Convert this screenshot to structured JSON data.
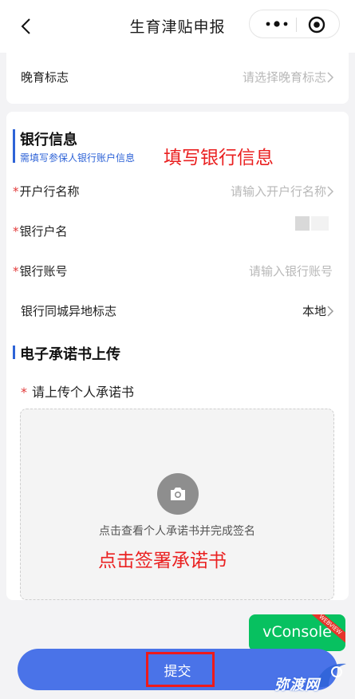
{
  "nav": {
    "title": "生育津贴申报",
    "back_icon": "chevron-left-icon",
    "more_icon": "more-dots-icon",
    "close_icon": "target-close-icon"
  },
  "late_birth": {
    "label": "晚育标志",
    "placeholder": "请选择晚育标志"
  },
  "bank": {
    "title": "银行信息",
    "subtitle": "需填写参保人银行账户信息",
    "annotation": "填写银行信息",
    "fields": [
      {
        "required": "*",
        "label": "开户行名称",
        "placeholder": "请输入开户行名称"
      },
      {
        "required": "*",
        "label": "银行户名",
        "value": ""
      },
      {
        "required": "*",
        "label": "银行账号",
        "placeholder": "请输入银行账号"
      },
      {
        "label": "银行同城异地标志",
        "value": "本地"
      }
    ]
  },
  "promise": {
    "title": "电子承诺书上传",
    "upload_required": "*",
    "upload_label": "请上传个人承诺书",
    "upload_hint": "点击查看个人承诺书并完成签名",
    "annotation": "点击签署承诺书",
    "camera_icon": "camera-icon"
  },
  "vconsole": {
    "label": "vConsole",
    "ribbon": "WEBVIEW"
  },
  "submit": {
    "label": "提交"
  },
  "watermark": {
    "text": "弥渡网"
  },
  "colors": {
    "accent": "#2e63d7",
    "annotation": "#ea2121",
    "submit": "#4a73e8",
    "vconsole": "#07c160"
  }
}
